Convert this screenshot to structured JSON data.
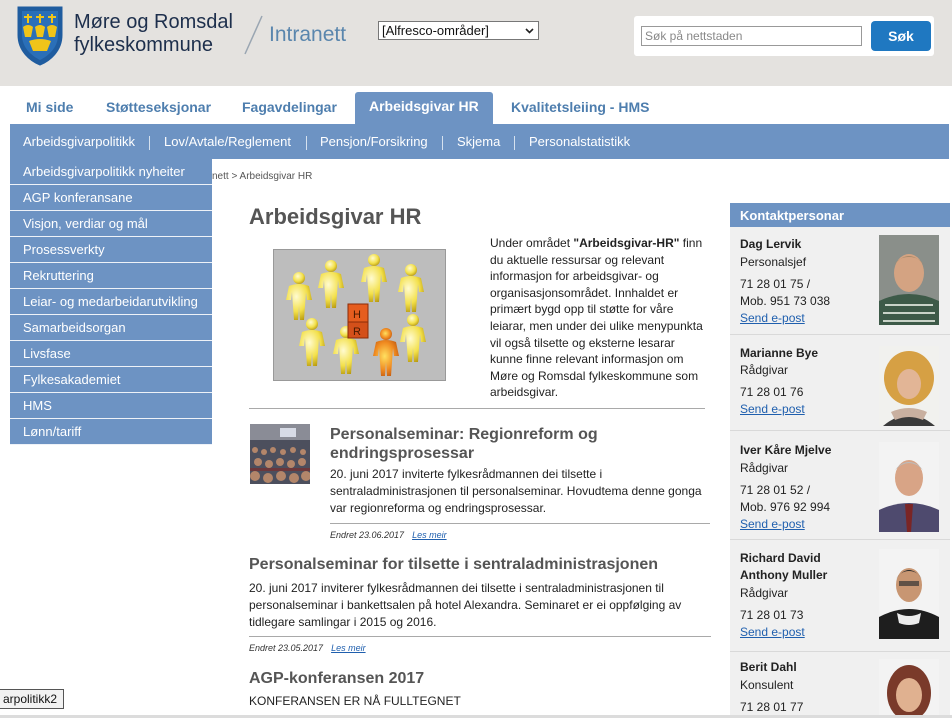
{
  "header": {
    "logo_line1": "Møre og Romsdal",
    "logo_line2": "fylkeskommune",
    "site_name": "Intranett",
    "area_select_value": "[Alfresco-områder]",
    "search_placeholder": "Søk på nettstaden",
    "search_button": "Søk"
  },
  "tabs": [
    {
      "label": "Mi side"
    },
    {
      "label": "Støtteseksjonar"
    },
    {
      "label": "Fagavdelingar"
    },
    {
      "label": "Arbeidsgivar HR",
      "active": true
    },
    {
      "label": "Kvalitetsleiing - HMS"
    }
  ],
  "subnav": [
    {
      "label": "Arbeidsgivarpolitikk"
    },
    {
      "label": "Lov/Avtale/Reglement"
    },
    {
      "label": "Pensjon/Forsikring"
    },
    {
      "label": "Skjema"
    },
    {
      "label": "Personalstatistikk"
    }
  ],
  "dropdown": [
    {
      "label": "Arbeidsgivarpolitikk nyheiter"
    },
    {
      "label": "AGP konferansane"
    },
    {
      "label": "Visjon, verdiar og mål"
    },
    {
      "label": "Prosessverkty"
    },
    {
      "label": "Rekruttering"
    },
    {
      "label": "Leiar- og medarbeidarutvikling"
    },
    {
      "label": "Samarbeidsorgan"
    },
    {
      "label": "Livsfase"
    },
    {
      "label": "Fylkesakademiet"
    },
    {
      "label": "HMS"
    },
    {
      "label": "Lønn/tariff"
    }
  ],
  "breadcrumb": "nett > Arbeidsgivar HR",
  "main": {
    "title": "Arbeidsgivar HR",
    "hero_letters": [
      "H",
      "R"
    ],
    "intro_before": "Under området ",
    "intro_bold": "\"Arbeidsgivar-HR\"",
    "intro_after": " finn du aktuelle ressursar og relevant informasjon for arbeidsgivar- og organisasjonsområdet. Innhaldet er primært bygd opp til støtte for våre leiarar, men under dei ulike menypunkta vil også tilsette og eksterne lesarar kunne finne relevant informasjon om Møre og Romsdal fylkeskommune som arbeidsgivar.",
    "news": [
      {
        "title": "Personalseminar: Regionreform og endringsprosessar",
        "text": "20. juni 2017 inviterte fylkesrådmannen dei tilsette i sentraladministrasjonen til personalseminar. Hovudtema denne gonga var regionreforma og endringsprosessar.",
        "meta": "Endret 23.06.2017",
        "more": "Les meir"
      },
      {
        "title": "Personalseminar for tilsette i sentraladministrasjonen",
        "text": "20. juni 2017 inviterer fylkesrådmannen dei tilsette i sentraladministrasjonen til personalseminar i bankettsalen på hotel Alexandra. Seminaret er ei oppfølging av tidlegare samlingar i 2015 og 2016.",
        "meta": "Endret 23.05.2017",
        "more": "Les meir"
      },
      {
        "title": "AGP-konferansen 2017",
        "text": "KONFERANSEN ER NÅ FULLTEGNET"
      }
    ]
  },
  "contacts": {
    "heading": "Kontaktpersonar",
    "people": [
      {
        "name": "Dag Lervik",
        "role": "Personalsjef",
        "phone": "71 28 01 75 /",
        "mobile": "Mob. 951 73 038",
        "email": "Send e-post"
      },
      {
        "name": "Marianne Bye",
        "role": "Rådgivar",
        "phone": "71 28 01 76",
        "email": "Send e-post"
      },
      {
        "name": "Iver Kåre Mjelve",
        "role": "Rådgivar",
        "phone": "71 28 01 52 /",
        "mobile": "Mob. 976 92 994",
        "email": "Send e-post"
      },
      {
        "name": "Richard David Anthony Muller",
        "role": "Rådgivar",
        "phone": "71 28 01 73",
        "email": "Send e-post"
      },
      {
        "name": "Berit Dahl",
        "role": "Konsulent",
        "phone": "71 28 01 77"
      }
    ]
  },
  "tooltip": "arpolitikk2",
  "colors": {
    "nav": "#6d93c3",
    "accent": "#1f78c1",
    "link": "#1f5fae",
    "header_bg": "#e4e2df"
  }
}
